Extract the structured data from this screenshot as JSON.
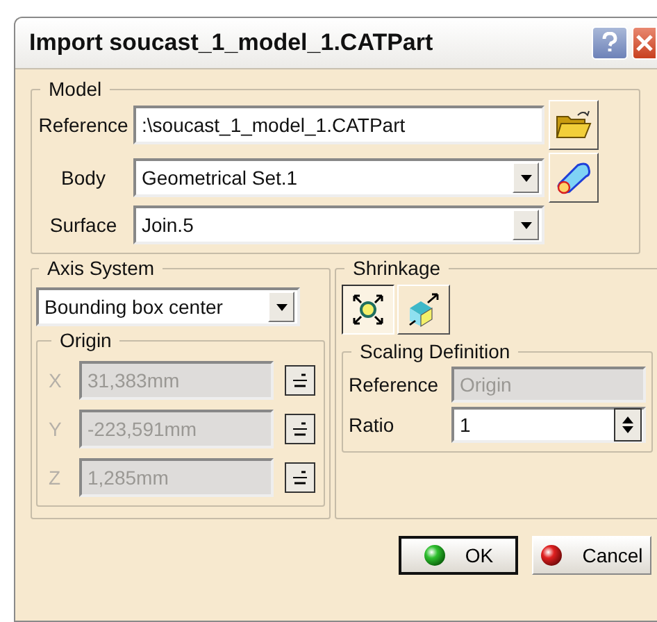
{
  "window": {
    "title": "Import soucast_1_model_1.CATPart"
  },
  "model": {
    "title": "Model",
    "reference": {
      "label": "Reference",
      "value": ":\\soucast_1_model_1.CATPart"
    },
    "body": {
      "label": "Body",
      "value": "Geometrical Set.1"
    },
    "surface": {
      "label": "Surface",
      "value": "Join.5"
    }
  },
  "axis_system": {
    "title": "Axis System",
    "value": "Bounding box center",
    "origin": {
      "title": "Origin",
      "fields": [
        {
          "label": "X",
          "value": "31,383mm",
          "disabled": true
        },
        {
          "label": "Y",
          "value": "-223,591mm",
          "disabled": true
        },
        {
          "label": "Z",
          "value": "1,285mm",
          "disabled": true
        }
      ]
    }
  },
  "shrinkage": {
    "title": "Shrinkage",
    "modes": [
      {
        "kind": "uniform",
        "selected": true
      },
      {
        "kind": "affinity",
        "selected": false
      }
    ],
    "scaling": {
      "title": "Scaling Definition",
      "reference": {
        "label": "Reference",
        "value": "Origin",
        "disabled": true
      },
      "ratio": {
        "label": "Ratio",
        "value": "1"
      }
    }
  },
  "buttons": [
    {
      "kind": "ok",
      "label": "OK"
    },
    {
      "kind": "cancel",
      "label": "Cancel"
    }
  ]
}
